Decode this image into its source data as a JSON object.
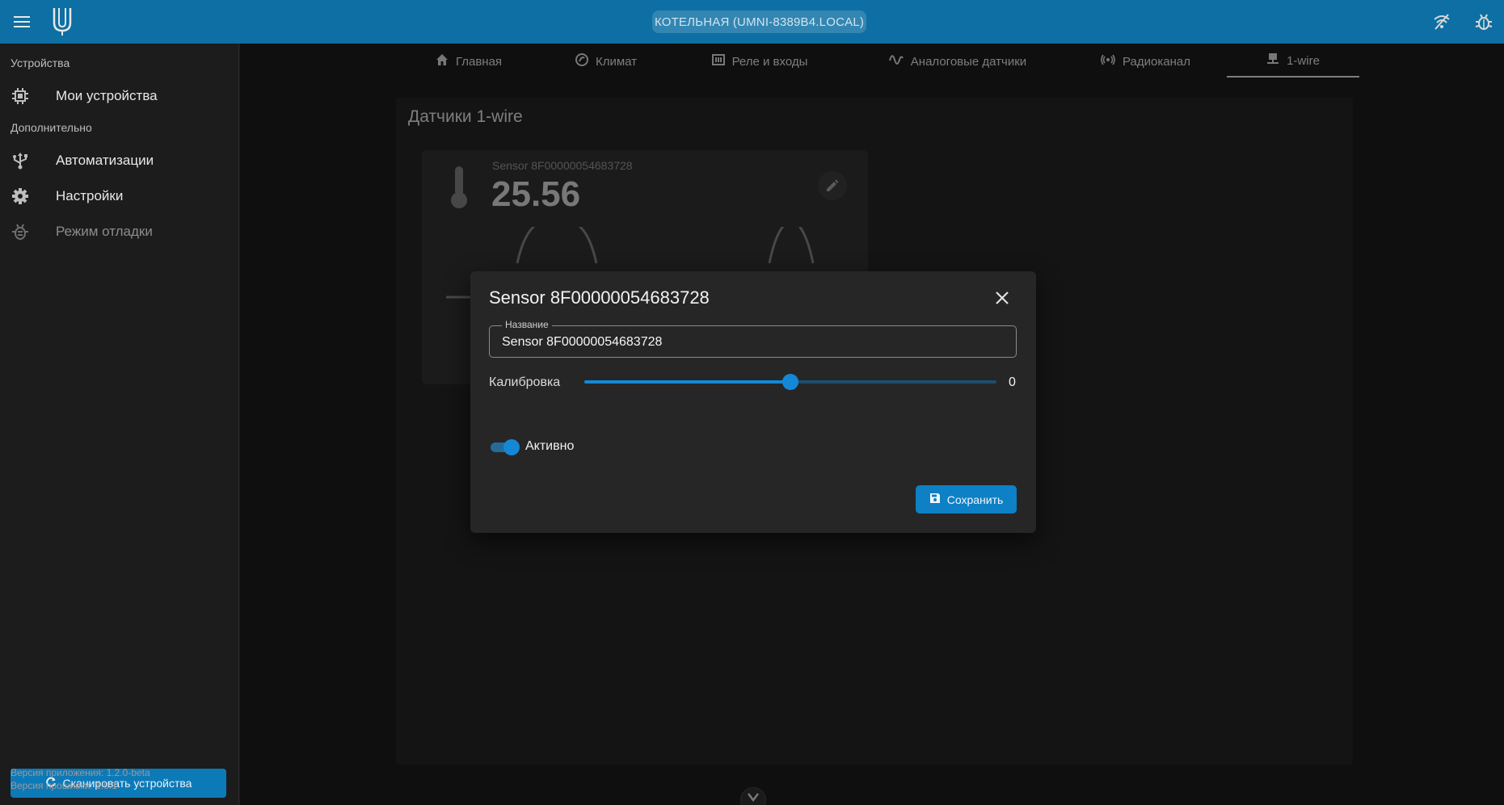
{
  "header": {
    "device_chip": "КОТЕЛЬНАЯ (UMNI-8389B4.LOCAL)",
    "icons": [
      "menu-icon",
      "logo",
      "wifi-off-icon",
      "bug-icon"
    ]
  },
  "sidebar": {
    "section_devices": "Устройства",
    "section_extra": "Дополнительно",
    "items": [
      {
        "label": "Мои устройства",
        "icon": "chip-icon"
      },
      {
        "label": "Автоматизации",
        "icon": "usb-icon"
      },
      {
        "label": "Настройки",
        "icon": "gear-icon"
      },
      {
        "label": "Режим отладки",
        "icon": "bug-icon",
        "disabled": true
      }
    ],
    "scan_button": "Сканировать устройства",
    "app_version": "Версия приложения: 1.2.0-beta",
    "fw_version": "Версия прошивки: 1.0.1"
  },
  "tabs": [
    {
      "label": "Главная",
      "icon": "home-icon"
    },
    {
      "label": "Климат",
      "icon": "climate-icon"
    },
    {
      "label": "Реле и входы",
      "icon": "relay-icon"
    },
    {
      "label": "Аналоговые датчики",
      "icon": "sine-icon"
    },
    {
      "label": "Радиоканал",
      "icon": "radio-icon"
    },
    {
      "label": "1-wire",
      "icon": "lan-icon",
      "active": true
    }
  ],
  "panel": {
    "title": "Датчики 1-wire",
    "sensor": {
      "name": "Sensor 8F00000054683728",
      "value": "25.56"
    }
  },
  "dialog": {
    "title": "Sensor 8F00000054683728",
    "name_label": "Название",
    "name_value": "Sensor 8F00000054683728",
    "calibration_label": "Калибровка",
    "calibration_value": "0",
    "calibration_position": 0.5,
    "active_label": "Активно",
    "active": true,
    "save_label": "Сохранить"
  },
  "colors": {
    "header": "#0d6fa3",
    "accent": "#1488d6",
    "background": "#1a1a1a"
  }
}
